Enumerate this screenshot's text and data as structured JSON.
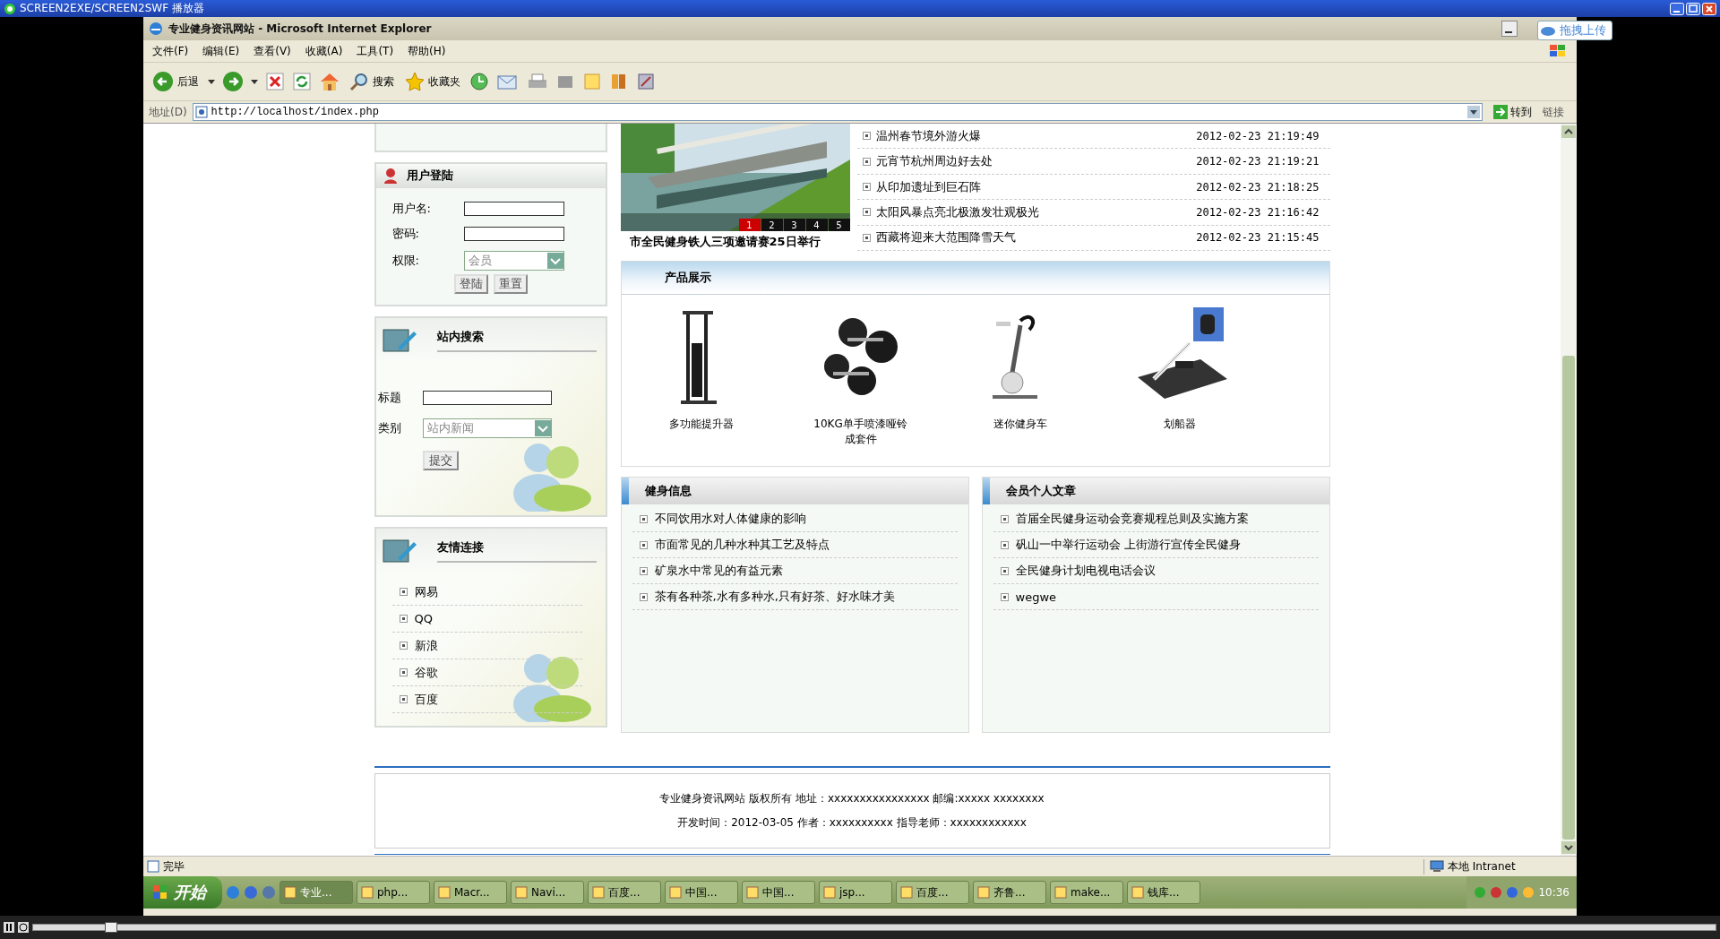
{
  "player": {
    "title": "SCREEN2EXE/SCREEN2SWF 播放器"
  },
  "browser": {
    "title": "专业健身资讯网站 - Microsoft Internet Explorer",
    "upload_button": "拖拽上传",
    "menu": [
      "文件(F)",
      "编辑(E)",
      "查看(V)",
      "收藏(A)",
      "工具(T)",
      "帮助(H)"
    ],
    "toolbar": {
      "back": "后退",
      "search": "搜索",
      "favorites": "收藏夹"
    },
    "address": {
      "label": "地址(D)",
      "url": "http://localhost/index.php",
      "go": "转到",
      "links": "链接"
    }
  },
  "login": {
    "title": "用户登陆",
    "fields": [
      {
        "label": "用户名:",
        "kind": "text"
      },
      {
        "label": "密码:",
        "kind": "text"
      },
      {
        "label": "权限:",
        "kind": "select",
        "value": "会员"
      }
    ],
    "buttons": [
      "登陆",
      "重置"
    ]
  },
  "site_search": {
    "title": "站内搜索",
    "fields": [
      {
        "label": "标题",
        "kind": "text"
      },
      {
        "label": "类别",
        "kind": "select",
        "value": "站内新闻"
      }
    ],
    "button": "提交"
  },
  "friend_links": {
    "title": "友情连接",
    "items": [
      "网易",
      "QQ",
      "新浪",
      "谷歌",
      "百度"
    ]
  },
  "slideshow": {
    "kind": "picture",
    "caption": "市全民健身铁人三项邀请赛25日举行",
    "pages": [
      {
        "label": "1",
        "selected": true
      },
      {
        "label": "2",
        "selected": false
      },
      {
        "label": "3",
        "selected": false
      },
      {
        "label": "4",
        "selected": false
      },
      {
        "label": "5",
        "selected": false
      }
    ]
  },
  "news": [
    {
      "title": "温州春节境外游火爆",
      "time": "2012-02-23 21:19:49"
    },
    {
      "title": "元宵节杭州周边好去处",
      "time": "2012-02-23 21:19:21"
    },
    {
      "title": "从印加遗址到巨石阵",
      "time": "2012-02-23 21:18:25"
    },
    {
      "title": "太阳风暴点亮北极激发壮观极光",
      "time": "2012-02-23 21:16:42"
    },
    {
      "title": "西藏将迎来大范围降雪天气",
      "time": "2012-02-23 21:15:45"
    }
  ],
  "products": {
    "title": "产品展示",
    "items": [
      {
        "name": "多功能提升器",
        "kind": "picture"
      },
      {
        "name": "10KG单手喷漆哑铃成套件",
        "kind": "picture"
      },
      {
        "name": "迷你健身车",
        "kind": "picture"
      },
      {
        "name": "划船器",
        "kind": "picture"
      }
    ]
  },
  "fitness_info": {
    "title": "健身信息",
    "items": [
      "不同饮用水对人体健康的影响",
      "市面常见的几种水种其工艺及特点",
      "矿泉水中常见的有益元素",
      "茶有各种茶,水有多种水,只有好茶、好水味才美"
    ]
  },
  "member_articles": {
    "title": "会员个人文章",
    "items": [
      "首届全民健身运动会竞赛规程总则及实施方案",
      "矾山一中举行运动会 上街游行宣传全民健身",
      "全民健身计划电视电话会议",
      "wegwe"
    ]
  },
  "footer": {
    "lines": [
      "专业健身资讯网站 版权所有 地址：xxxxxxxxxxxxxxxx 邮编:xxxxx xxxxxxxx",
      "开发时间：2012-03-05 作者：xxxxxxxxxx 指导老师：xxxxxxxxxxxx"
    ]
  },
  "status_bar": {
    "text": "完毕",
    "zone": "本地 Intranet"
  },
  "taskbar": {
    "start": "开始",
    "tasks": [
      {
        "label": "专业...",
        "selected": true
      },
      {
        "label": "php...",
        "selected": false
      },
      {
        "label": "Macr...",
        "selected": false
      },
      {
        "label": "Navi...",
        "selected": false
      },
      {
        "label": "百度...",
        "selected": false
      },
      {
        "label": "中国...",
        "selected": false
      },
      {
        "label": "中国...",
        "selected": false
      },
      {
        "label": "jsp...",
        "selected": false
      },
      {
        "label": "百度...",
        "selected": false
      },
      {
        "label": "齐鲁...",
        "selected": false
      },
      {
        "label": "make...",
        "selected": false
      },
      {
        "label": "钱库...",
        "selected": false
      }
    ],
    "clock": "10:36"
  }
}
